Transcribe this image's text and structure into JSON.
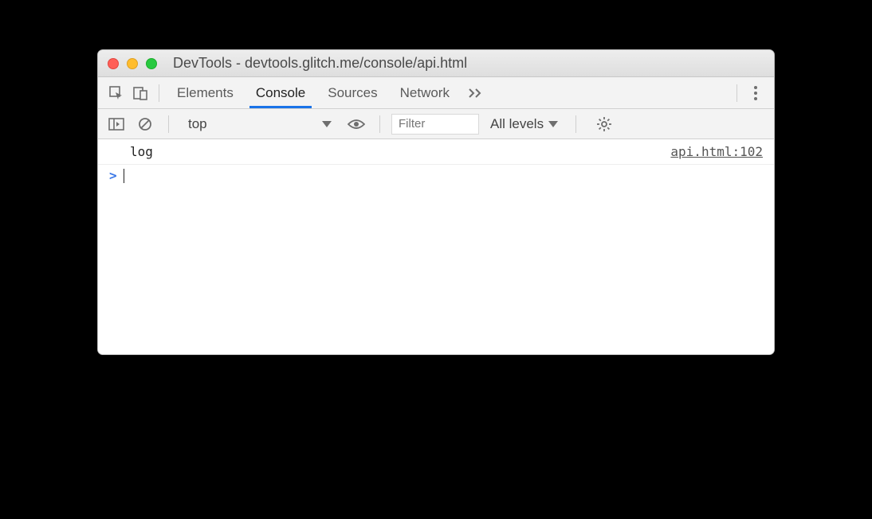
{
  "window": {
    "title": "DevTools - devtools.glitch.me/console/api.html"
  },
  "tabs": {
    "elements": "Elements",
    "console": "Console",
    "sources": "Sources",
    "network": "Network"
  },
  "subtoolbar": {
    "context": "top",
    "filter_placeholder": "Filter",
    "levels": "All levels"
  },
  "console": {
    "log_message": "log",
    "source_link": "api.html:102",
    "prompt": ">"
  }
}
